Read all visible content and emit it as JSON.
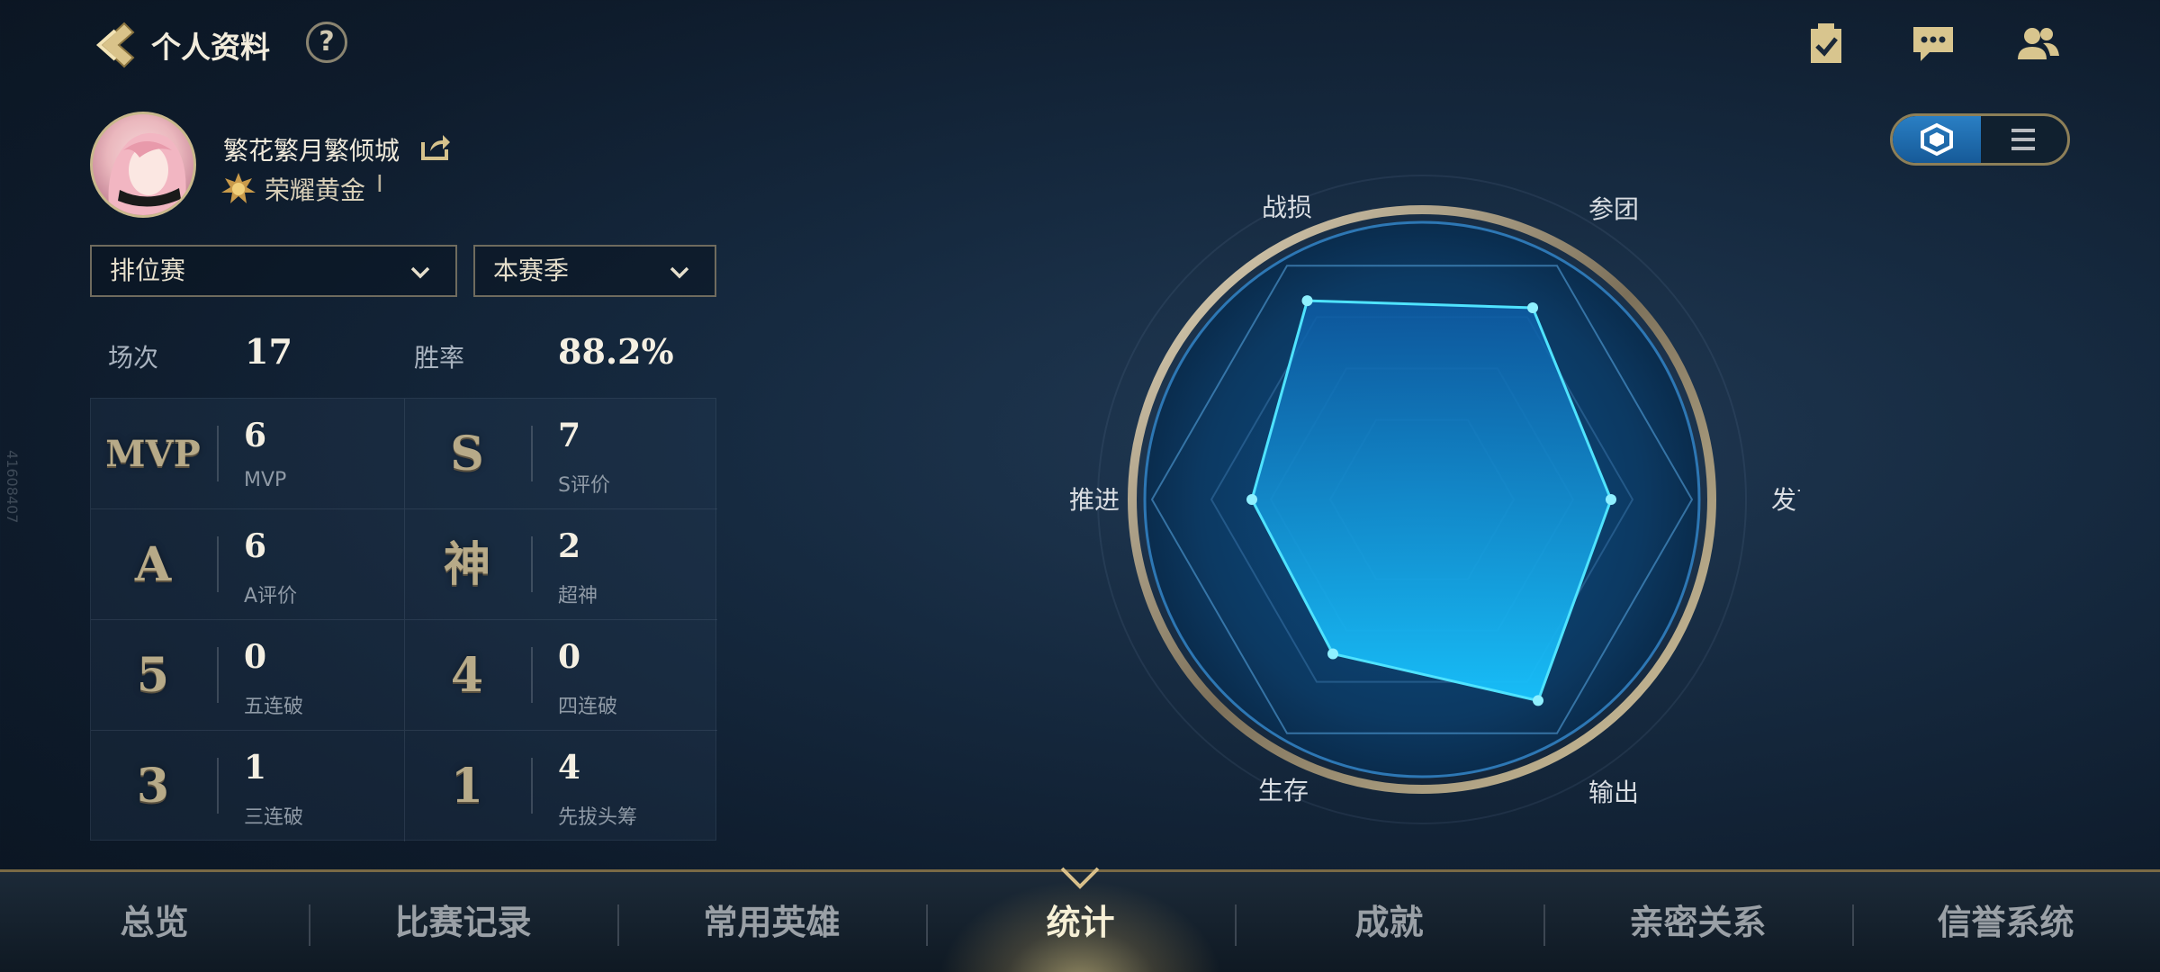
{
  "header": {
    "title": "个人资料",
    "help_label": "?"
  },
  "top_icons": [
    "task-checklist-icon",
    "chat-message-icon",
    "friends-icon"
  ],
  "profile": {
    "name": "繁花繁月繁倾城",
    "rank": "荣耀黄金",
    "rank_stars": "I"
  },
  "filters": {
    "mode": "排位赛",
    "season": "本赛季"
  },
  "totals": {
    "matches_label": "场次",
    "matches_value": "17",
    "winrate_label": "胜率",
    "winrate_value": "88.2%"
  },
  "stats": [
    {
      "emblem": "MVP",
      "value": "6",
      "label": "MVP"
    },
    {
      "emblem": "S",
      "value": "7",
      "label": "S评价"
    },
    {
      "emblem": "A",
      "value": "6",
      "label": "A评价"
    },
    {
      "emblem": "神",
      "value": "2",
      "label": "超神"
    },
    {
      "emblem": "5",
      "value": "0",
      "label": "五连破"
    },
    {
      "emblem": "4",
      "value": "0",
      "label": "四连破"
    },
    {
      "emblem": "3",
      "value": "1",
      "label": "三连破"
    },
    {
      "emblem": "1",
      "value": "4",
      "label": "先拔头筹"
    }
  ],
  "radar": {
    "axes": [
      "战损",
      "参团",
      "发育",
      "输出",
      "生存",
      "推进"
    ],
    "values": [
      0.85,
      0.82,
      0.7,
      0.86,
      0.66,
      0.63
    ],
    "fill_color": "#14a8e8",
    "line_color": "#4fe3ff"
  },
  "side_id": "41608407",
  "nav": {
    "items": [
      "总览",
      "比赛记录",
      "常用英雄",
      "统计",
      "成就",
      "亲密关系",
      "信誉系统"
    ],
    "active": "统计"
  }
}
